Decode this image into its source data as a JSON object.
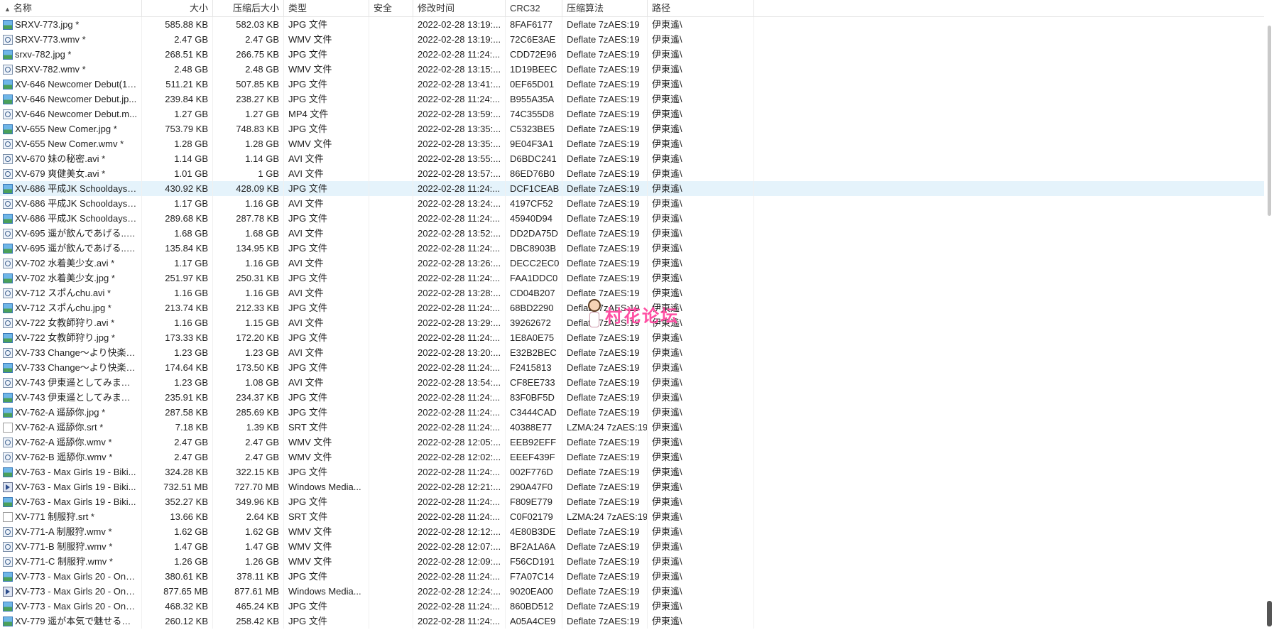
{
  "columns": {
    "name": "名称",
    "size": "大小",
    "packed": "压缩后大小",
    "type": "类型",
    "security": "安全",
    "mtime": "修改时间",
    "crc": "CRC32",
    "method": "压缩算法",
    "path": "路径"
  },
  "rows": [
    {
      "name": "SRXV-773.jpg *",
      "size": "585.88 KB",
      "packed": "582.03 KB",
      "type": "JPG 文件",
      "mtime": "2022-02-28 13:19:...",
      "crc": "8FAF6177",
      "method": "Deflate 7zAES:19",
      "path": "伊東遙\\",
      "icon": "image-file-icon"
    },
    {
      "name": "SRXV-773.wmv *",
      "size": "2.47 GB",
      "packed": "2.47 GB",
      "type": "WMV 文件",
      "mtime": "2022-02-28 13:19:...",
      "crc": "72C6E3AE",
      "method": "Deflate 7zAES:19",
      "path": "伊東遙\\",
      "icon": "video-file-icon"
    },
    {
      "name": "srxv-782.jpg *",
      "size": "268.51 KB",
      "packed": "266.75 KB",
      "type": "JPG 文件",
      "mtime": "2022-02-28 11:24:...",
      "crc": "CDD72E96",
      "method": "Deflate 7zAES:19",
      "path": "伊東遙\\",
      "icon": "image-file-icon"
    },
    {
      "name": "SRXV-782.wmv *",
      "size": "2.48 GB",
      "packed": "2.48 GB",
      "type": "WMV 文件",
      "mtime": "2022-02-28 13:15:...",
      "crc": "1D19BEEC",
      "method": "Deflate 7zAES:19",
      "path": "伊東遙\\",
      "icon": "video-file-icon"
    },
    {
      "name": "XV-646 Newcomer Debut(1)...",
      "size": "511.21 KB",
      "packed": "507.85 KB",
      "type": "JPG 文件",
      "mtime": "2022-02-28 13:41:...",
      "crc": "0EF65D01",
      "method": "Deflate 7zAES:19",
      "path": "伊東遙\\",
      "icon": "image-file-icon"
    },
    {
      "name": "XV-646 Newcomer Debut.jp...",
      "size": "239.84 KB",
      "packed": "238.27 KB",
      "type": "JPG 文件",
      "mtime": "2022-02-28 11:24:...",
      "crc": "B955A35A",
      "method": "Deflate 7zAES:19",
      "path": "伊東遙\\",
      "icon": "image-file-icon"
    },
    {
      "name": "XV-646 Newcomer Debut.m...",
      "size": "1.27 GB",
      "packed": "1.27 GB",
      "type": "MP4 文件",
      "mtime": "2022-02-28 13:59:...",
      "crc": "74C355D8",
      "method": "Deflate 7zAES:19",
      "path": "伊東遙\\",
      "icon": "video-file-icon"
    },
    {
      "name": "XV-655 New Comer.jpg *",
      "size": "753.79 KB",
      "packed": "748.83 KB",
      "type": "JPG 文件",
      "mtime": "2022-02-28 13:35:...",
      "crc": "C5323BE5",
      "method": "Deflate 7zAES:19",
      "path": "伊東遙\\",
      "icon": "image-file-icon"
    },
    {
      "name": "XV-655 New Comer.wmv *",
      "size": "1.28 GB",
      "packed": "1.28 GB",
      "type": "WMV 文件",
      "mtime": "2022-02-28 13:35:...",
      "crc": "9E04F3A1",
      "method": "Deflate 7zAES:19",
      "path": "伊東遙\\",
      "icon": "video-file-icon"
    },
    {
      "name": "XV-670 妹の秘密.avi *",
      "size": "1.14 GB",
      "packed": "1.14 GB",
      "type": "AVI 文件",
      "mtime": "2022-02-28 13:55:...",
      "crc": "D6BDC241",
      "method": "Deflate 7zAES:19",
      "path": "伊東遙\\",
      "icon": "video-file-icon"
    },
    {
      "name": "XV-679 爽健美女.avi *",
      "size": "1.01 GB",
      "packed": "1 GB",
      "type": "AVI 文件",
      "mtime": "2022-02-28 13:57:...",
      "crc": "86ED76B0",
      "method": "Deflate 7zAES:19",
      "path": "伊東遙\\",
      "icon": "video-file-icon"
    },
    {
      "name": "XV-686 平成JK Schooldays ...",
      "size": "430.92 KB",
      "packed": "428.09 KB",
      "type": "JPG 文件",
      "mtime": "2022-02-28 11:24:...",
      "crc": "DCF1CEAB",
      "method": "Deflate 7zAES:19",
      "path": "伊東遙\\",
      "icon": "image-file-icon",
      "selected": true
    },
    {
      "name": "XV-686 平成JK Schooldays.a...",
      "size": "1.17 GB",
      "packed": "1.16 GB",
      "type": "AVI 文件",
      "mtime": "2022-02-28 13:24:...",
      "crc": "4197CF52",
      "method": "Deflate 7zAES:19",
      "path": "伊東遙\\",
      "icon": "video-file-icon"
    },
    {
      "name": "XV-686 平成JK Schooldays.j...",
      "size": "289.68 KB",
      "packed": "287.78 KB",
      "type": "JPG 文件",
      "mtime": "2022-02-28 11:24:...",
      "crc": "45940D94",
      "method": "Deflate 7zAES:19",
      "path": "伊東遙\\",
      "icon": "image-file-icon"
    },
    {
      "name": "XV-695 遥が飲んであげる....a...",
      "size": "1.68 GB",
      "packed": "1.68 GB",
      "type": "AVI 文件",
      "mtime": "2022-02-28 13:52:...",
      "crc": "DD2DA75D",
      "method": "Deflate 7zAES:19",
      "path": "伊東遙\\",
      "icon": "video-file-icon"
    },
    {
      "name": "XV-695 遥が飲んであげる....j...",
      "size": "135.84 KB",
      "packed": "134.95 KB",
      "type": "JPG 文件",
      "mtime": "2022-02-28 11:24:...",
      "crc": "DBC8903B",
      "method": "Deflate 7zAES:19",
      "path": "伊東遙\\",
      "icon": "image-file-icon"
    },
    {
      "name": "XV-702 水着美少女.avi *",
      "size": "1.17 GB",
      "packed": "1.16 GB",
      "type": "AVI 文件",
      "mtime": "2022-02-28 13:26:...",
      "crc": "DECC2EC0",
      "method": "Deflate 7zAES:19",
      "path": "伊東遙\\",
      "icon": "video-file-icon"
    },
    {
      "name": "XV-702 水着美少女.jpg *",
      "size": "251.97 KB",
      "packed": "250.31 KB",
      "type": "JPG 文件",
      "mtime": "2022-02-28 11:24:...",
      "crc": "FAA1DDC0",
      "method": "Deflate 7zAES:19",
      "path": "伊東遙\\",
      "icon": "image-file-icon"
    },
    {
      "name": "XV-712 スポんchu.avi *",
      "size": "1.16 GB",
      "packed": "1.16 GB",
      "type": "AVI 文件",
      "mtime": "2022-02-28 13:28:...",
      "crc": "CD04B207",
      "method": "Deflate 7zAES:19",
      "path": "伊東遙\\",
      "icon": "video-file-icon"
    },
    {
      "name": "XV-712 スポんchu.jpg *",
      "size": "213.74 KB",
      "packed": "212.33 KB",
      "type": "JPG 文件",
      "mtime": "2022-02-28 11:24:...",
      "crc": "68BD2290",
      "method": "Deflate 7zAES:19",
      "path": "伊東遙\\",
      "icon": "image-file-icon"
    },
    {
      "name": "XV-722 女教師狩り.avi *",
      "size": "1.16 GB",
      "packed": "1.15 GB",
      "type": "AVI 文件",
      "mtime": "2022-02-28 13:29:...",
      "crc": "39262672",
      "method": "Deflate 7zAES:19",
      "path": "伊東遙\\",
      "icon": "video-file-icon"
    },
    {
      "name": "XV-722 女教師狩り.jpg *",
      "size": "173.33 KB",
      "packed": "172.20 KB",
      "type": "JPG 文件",
      "mtime": "2022-02-28 11:24:...",
      "crc": "1E8A0E75",
      "method": "Deflate 7zAES:19",
      "path": "伊東遙\\",
      "icon": "image-file-icon"
    },
    {
      "name": "XV-733 Change～より快楽を...",
      "size": "1.23 GB",
      "packed": "1.23 GB",
      "type": "AVI 文件",
      "mtime": "2022-02-28 13:20:...",
      "crc": "E32B2BEC",
      "method": "Deflate 7zAES:19",
      "path": "伊東遙\\",
      "icon": "video-file-icon"
    },
    {
      "name": "XV-733 Change～より快楽を...",
      "size": "174.64 KB",
      "packed": "173.50 KB",
      "type": "JPG 文件",
      "mtime": "2022-02-28 11:24:...",
      "crc": "F2415813",
      "method": "Deflate 7zAES:19",
      "path": "伊東遙\\",
      "icon": "image-file-icon"
    },
    {
      "name": "XV-743 伊東遥としてみませ...",
      "size": "1.23 GB",
      "packed": "1.08 GB",
      "type": "AVI 文件",
      "mtime": "2022-02-28 13:54:...",
      "crc": "CF8EE733",
      "method": "Deflate 7zAES:19",
      "path": "伊東遙\\",
      "icon": "video-file-icon"
    },
    {
      "name": "XV-743 伊東遥としてみませ...",
      "size": "235.91 KB",
      "packed": "234.37 KB",
      "type": "JPG 文件",
      "mtime": "2022-02-28 11:24:...",
      "crc": "83F0BF5D",
      "method": "Deflate 7zAES:19",
      "path": "伊東遙\\",
      "icon": "image-file-icon"
    },
    {
      "name": "XV-762-A 遥舔你.jpg *",
      "size": "287.58 KB",
      "packed": "285.69 KB",
      "type": "JPG 文件",
      "mtime": "2022-02-28 11:24:...",
      "crc": "C3444CAD",
      "method": "Deflate 7zAES:19",
      "path": "伊東遙\\",
      "icon": "image-file-icon"
    },
    {
      "name": "XV-762-A 遥舔你.srt *",
      "size": "7.18 KB",
      "packed": "1.39 KB",
      "type": "SRT 文件",
      "mtime": "2022-02-28 11:24:...",
      "crc": "40388E77",
      "method": "LZMA:24 7zAES:19",
      "path": "伊東遙\\",
      "icon": "text-file-icon"
    },
    {
      "name": "XV-762-A 遥舔你.wmv *",
      "size": "2.47 GB",
      "packed": "2.47 GB",
      "type": "WMV 文件",
      "mtime": "2022-02-28 12:05:...",
      "crc": "EEB92EFF",
      "method": "Deflate 7zAES:19",
      "path": "伊東遙\\",
      "icon": "video-file-icon"
    },
    {
      "name": "XV-762-B 遥舔你.wmv *",
      "size": "2.47 GB",
      "packed": "2.47 GB",
      "type": "WMV 文件",
      "mtime": "2022-02-28 12:02:...",
      "crc": "EEEF439F",
      "method": "Deflate 7zAES:19",
      "path": "伊東遙\\",
      "icon": "video-file-icon"
    },
    {
      "name": "XV-763 - Max Girls 19 - Biki...",
      "size": "324.28 KB",
      "packed": "322.15 KB",
      "type": "JPG 文件",
      "mtime": "2022-02-28 11:24:...",
      "crc": "002F776D",
      "method": "Deflate 7zAES:19",
      "path": "伊東遙\\",
      "icon": "image-file-icon"
    },
    {
      "name": "XV-763 - Max Girls 19 - Biki...",
      "size": "732.51 MB",
      "packed": "727.70 MB",
      "type": "Windows Media...",
      "mtime": "2022-02-28 12:21:...",
      "crc": "290A47F0",
      "method": "Deflate 7zAES:19",
      "path": "伊東遙\\",
      "icon": "media-file-icon"
    },
    {
      "name": "XV-763 - Max Girls 19 - Biki...",
      "size": "352.27 KB",
      "packed": "349.96 KB",
      "type": "JPG 文件",
      "mtime": "2022-02-28 11:24:...",
      "crc": "F809E779",
      "method": "Deflate 7zAES:19",
      "path": "伊東遙\\",
      "icon": "image-file-icon"
    },
    {
      "name": "XV-771 制服狩.srt *",
      "size": "13.66 KB",
      "packed": "2.64 KB",
      "type": "SRT 文件",
      "mtime": "2022-02-28 11:24:...",
      "crc": "C0F02179",
      "method": "LZMA:24 7zAES:19",
      "path": "伊東遙\\",
      "icon": "text-file-icon"
    },
    {
      "name": "XV-771-A 制服狩.wmv *",
      "size": "1.62 GB",
      "packed": "1.62 GB",
      "type": "WMV 文件",
      "mtime": "2022-02-28 12:12:...",
      "crc": "4E80B3DE",
      "method": "Deflate 7zAES:19",
      "path": "伊東遙\\",
      "icon": "video-file-icon"
    },
    {
      "name": "XV-771-B 制服狩.wmv *",
      "size": "1.47 GB",
      "packed": "1.47 GB",
      "type": "WMV 文件",
      "mtime": "2022-02-28 12:07:...",
      "crc": "BF2A1A6A",
      "method": "Deflate 7zAES:19",
      "path": "伊東遙\\",
      "icon": "video-file-icon"
    },
    {
      "name": "XV-771-C 制服狩.wmv *",
      "size": "1.26 GB",
      "packed": "1.26 GB",
      "type": "WMV 文件",
      "mtime": "2022-02-28 12:09:...",
      "crc": "F56CD191",
      "method": "Deflate 7zAES:19",
      "path": "伊東遙\\",
      "icon": "video-file-icon"
    },
    {
      "name": "XV-773 - Max Girls 20 - Ons...",
      "size": "380.61 KB",
      "packed": "378.11 KB",
      "type": "JPG 文件",
      "mtime": "2022-02-28 11:24:...",
      "crc": "F7A07C14",
      "method": "Deflate 7zAES:19",
      "path": "伊東遙\\",
      "icon": "image-file-icon"
    },
    {
      "name": "XV-773 - Max Girls 20 - Ons...",
      "size": "877.65 MB",
      "packed": "877.61 MB",
      "type": "Windows Media...",
      "mtime": "2022-02-28 12:24:...",
      "crc": "9020EA00",
      "method": "Deflate 7zAES:19",
      "path": "伊東遙\\",
      "icon": "media-file-icon"
    },
    {
      "name": "XV-773 - Max Girls 20 - Ons...",
      "size": "468.32 KB",
      "packed": "465.24 KB",
      "type": "JPG 文件",
      "mtime": "2022-02-28 11:24:...",
      "crc": "860BD512",
      "method": "Deflate 7zAES:19",
      "path": "伊東遙\\",
      "icon": "image-file-icon"
    },
    {
      "name": "XV-779 遥が本気で魅せるお...",
      "size": "260.12 KB",
      "packed": "258.42 KB",
      "type": "JPG 文件",
      "mtime": "2022-02-28 11:24:...",
      "crc": "A05A4CE9",
      "method": "Deflate 7zAES:19",
      "path": "伊東遙\\",
      "icon": "image-file-icon"
    }
  ],
  "watermark": {
    "text": "村花论坛"
  }
}
